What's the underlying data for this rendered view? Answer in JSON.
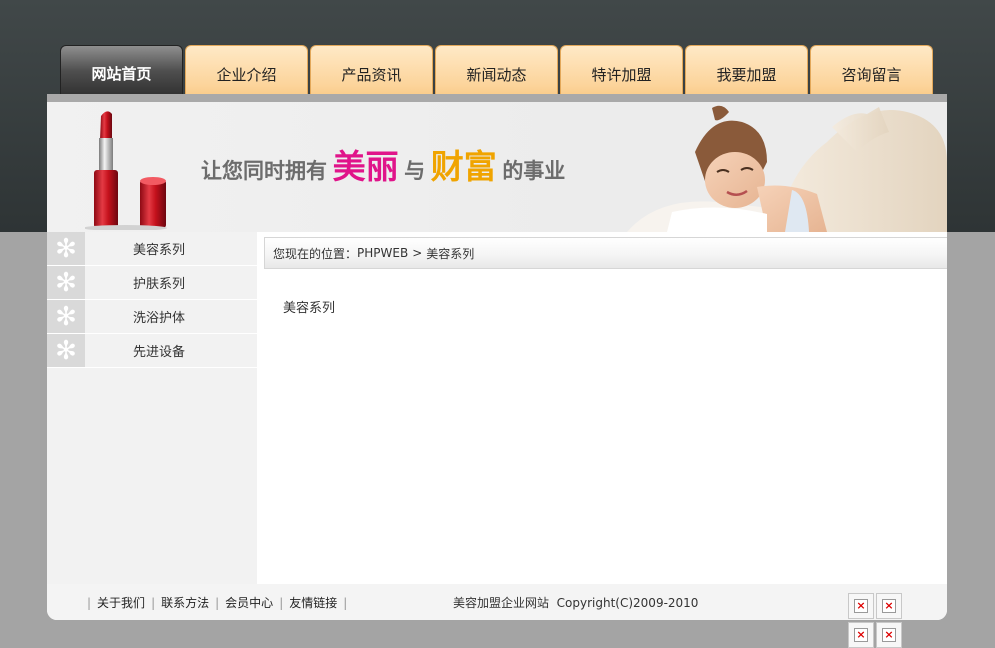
{
  "nav": {
    "items": [
      {
        "label": "网站首页",
        "active": true
      },
      {
        "label": "企业介绍"
      },
      {
        "label": "产品资讯"
      },
      {
        "label": "新闻动态"
      },
      {
        "label": "特许加盟"
      },
      {
        "label": "我要加盟"
      },
      {
        "label": "咨询留言"
      }
    ]
  },
  "banner": {
    "slogan_part1": "让您同时拥有",
    "slogan_highlight1": "美丽",
    "slogan_part2": "与",
    "slogan_highlight2": "财富",
    "slogan_part3": "的事业",
    "colors": {
      "pink": "#e0148a",
      "gold": "#f0a400"
    }
  },
  "sidebar": {
    "items": [
      {
        "label": "美容系列",
        "icon": "snowflake-icon"
      },
      {
        "label": "护肤系列",
        "icon": "snowflake-icon"
      },
      {
        "label": "洗浴护体",
        "icon": "snowflake-icon"
      },
      {
        "label": "先进设备",
        "icon": "snowflake-icon"
      }
    ]
  },
  "breadcrumb": {
    "prefix": "您现在的位置：",
    "home": "PHPWEB",
    "separator": ">",
    "current": "美容系列"
  },
  "main": {
    "title": "美容系列"
  },
  "footer": {
    "links": [
      "关于我们",
      "联系方法",
      "会员中心",
      "友情链接"
    ],
    "site_name": "美容加盟企业网站",
    "copyright": "Copyright(C)2009-2010"
  }
}
